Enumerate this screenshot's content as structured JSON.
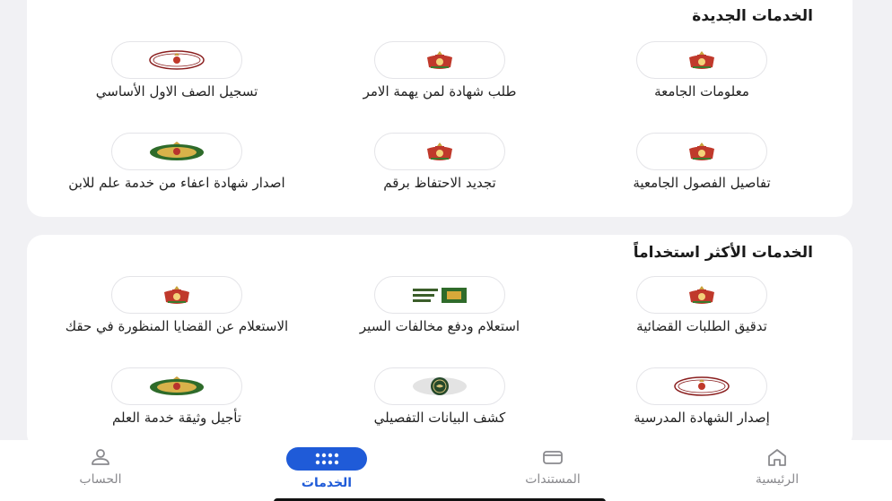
{
  "sections": {
    "new": {
      "title": "الخدمات الجديدة",
      "items": [
        {
          "label": "معلومات الجامعة",
          "icon": "crest-icon"
        },
        {
          "label": "طلب شهادة لمن يهمة الامر",
          "icon": "crest-icon"
        },
        {
          "label": "تسجيل الصف الاول الأساسي",
          "icon": "ministry-seal-icon"
        },
        {
          "label": "تفاصيل الفصول الجامعية",
          "icon": "crest-icon"
        },
        {
          "label": "تجديد الاحتفاظ برقم",
          "icon": "crest-icon"
        },
        {
          "label": "اصدار شهادة اعفاء من خدمة علم للابن",
          "icon": "army-badge-icon"
        }
      ]
    },
    "most_used": {
      "title": "الخدمات الأكثر استخداماً",
      "items": [
        {
          "label": "تدقيق الطلبات القضائية",
          "icon": "crest-icon"
        },
        {
          "label": "استعلام ودفع مخالفات السير",
          "icon": "traffic-logo-icon"
        },
        {
          "label": "الاستعلام عن القضايا المنظورة في حقك",
          "icon": "crest-icon"
        },
        {
          "label": "إصدار الشهادة المدرسية",
          "icon": "ministry-seal-icon"
        },
        {
          "label": "كشف البيانات التفصيلي",
          "icon": "green-seal-icon"
        },
        {
          "label": "تأجيل وثيقة خدمة العلم",
          "icon": "army-badge-icon"
        }
      ]
    }
  },
  "tabbar": {
    "home": "الرئيسية",
    "documents": "المستندات",
    "services": "الخدمات",
    "account": "الحساب"
  },
  "colors": {
    "accent": "#1f5bd8",
    "inactive": "#8a8a8e",
    "background": "#f1f1f4"
  }
}
